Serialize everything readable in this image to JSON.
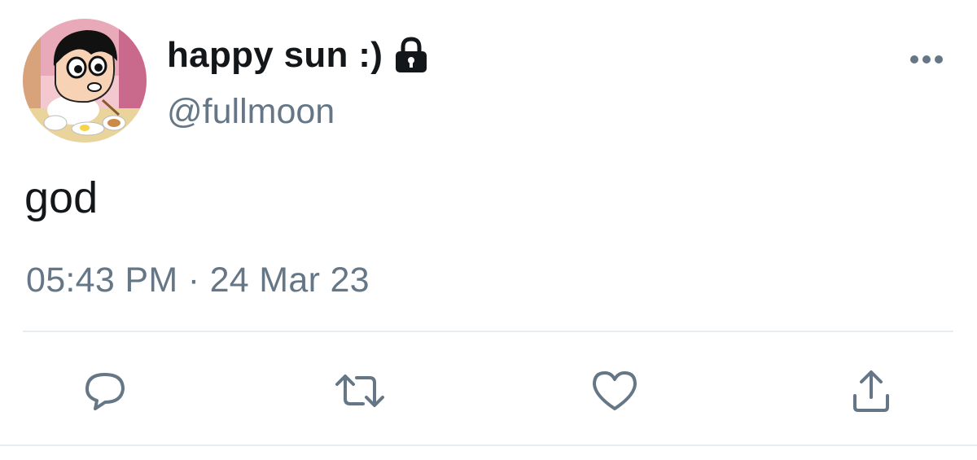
{
  "user": {
    "display_name": "happy sun :)",
    "handle": "@fullmoon",
    "protected_icon": "lock-icon",
    "avatar": "cartoon-avatar"
  },
  "tweet": {
    "text": "god",
    "timestamp": "05:43 PM · 24 Mar 23"
  },
  "actions": {
    "reply_icon": "reply-icon",
    "retweet_icon": "retweet-icon",
    "like_icon": "heart-icon",
    "share_icon": "share-icon",
    "more_icon": "more-icon"
  },
  "colors": {
    "text_primary": "#14171a",
    "text_secondary": "#657786",
    "divider": "#e6ecf0"
  }
}
